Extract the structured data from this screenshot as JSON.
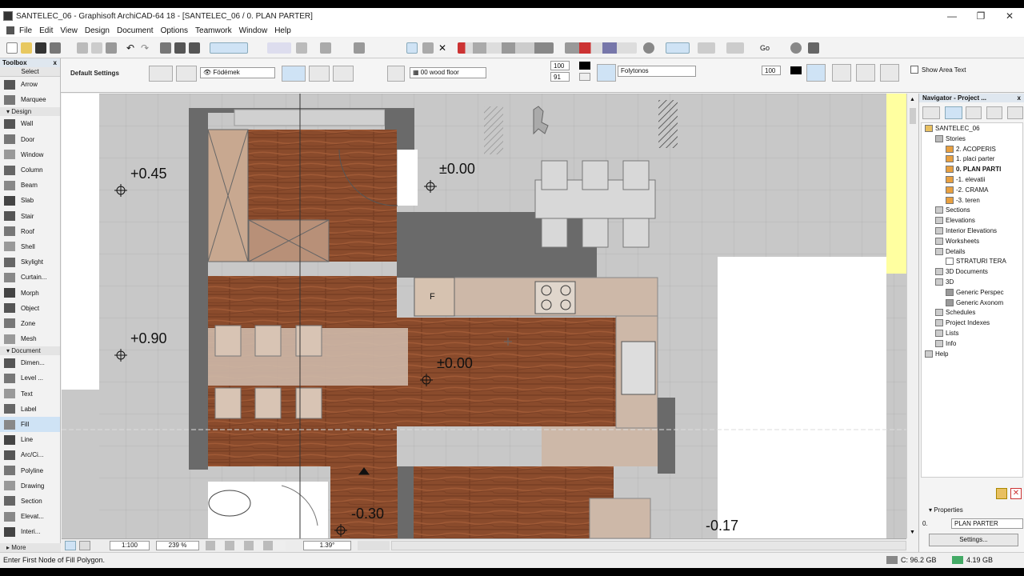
{
  "window": {
    "title": "SANTELEC_06 - Graphisoft ArchiCAD-64 18 - [SANTELEC_06 / 0. PLAN PARTER]",
    "controls": {
      "minimize": "—",
      "restore": "❐",
      "close": "✕"
    }
  },
  "menu": [
    "File",
    "Edit",
    "View",
    "Design",
    "Document",
    "Options",
    "Teamwork",
    "Window",
    "Help"
  ],
  "toolbar": {
    "goto_label": "Go"
  },
  "infobox": {
    "label": "Default Settings",
    "layer": "Födémek",
    "fill_name": "00 wood floor",
    "pen_a": "100",
    "pen_b": "91",
    "line_type": "Folytonos",
    "bg_pen": "100",
    "show_area_text": "Show Area Text"
  },
  "toolbox": {
    "title": "Toolbox",
    "close": "x",
    "select_label": "Select",
    "pointer_tools": [
      "Arrow",
      "Marquee"
    ],
    "design_group": "Design",
    "design_tools": [
      "Wall",
      "Door",
      "Window",
      "Column",
      "Beam",
      "Slab",
      "Stair",
      "Roof",
      "Shell",
      "Skylight",
      "Curtain...",
      "Morph",
      "Object",
      "Zone",
      "Mesh"
    ],
    "document_group": "Document",
    "document_tools": [
      "Dimen...",
      "Level ...",
      "Text",
      "Label",
      "Fill",
      "Line",
      "Arc/Ci...",
      "Polyline",
      "Drawing",
      "Section",
      "Elevat...",
      "Interi..."
    ],
    "active_tool": "Fill",
    "more_label": "More"
  },
  "canvas": {
    "elevations": [
      "+0.45",
      "±0.00",
      "+0.90",
      "±0.00",
      "-0.30",
      "-0.17"
    ],
    "fridge_label": "F"
  },
  "navigator": {
    "title": "Navigator - Project ...",
    "close": "x",
    "project": "SANTELEC_06",
    "stories_label": "Stories",
    "stories": [
      "2. ACOPERIS",
      "1. placi parter",
      "0. PLAN PARTI",
      "-1. elevatii",
      "-2. CRAMA",
      "-3. teren"
    ],
    "items": [
      "Sections",
      "Elevations",
      "Interior Elevations",
      "Worksheets",
      "Details"
    ],
    "detail_child": "STRATURI TERA",
    "items2": [
      "3D Documents",
      "3D"
    ],
    "threed_children": [
      "Generic Perspec",
      "Generic Axonom"
    ],
    "items3": [
      "Schedules",
      "Project Indexes",
      "Lists",
      "Info"
    ],
    "help": "Help",
    "properties_label": "Properties",
    "prop_id": "0.",
    "prop_value": "PLAN PARTER",
    "settings_button": "Settings..."
  },
  "bottombar": {
    "scale": "1:100",
    "zoom": "239 %",
    "angle": "1.39°"
  },
  "status": {
    "hint": "Enter First Node of Fill Polygon.",
    "disk": "C: 96.2 GB",
    "ram": "4.19 GB"
  },
  "colors": {
    "wood": "#8a4b2c",
    "wall": "#6a6a6a",
    "light_floor": "#cdb8a8",
    "grid_bg": "#c8c8c8",
    "yellow_strip": "#ffffa0",
    "active_tool": "#cfe3f5"
  }
}
